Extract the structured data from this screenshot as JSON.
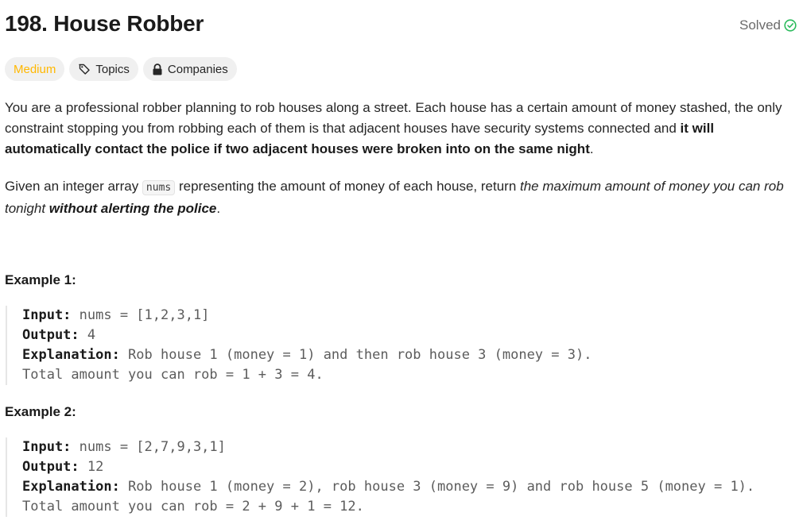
{
  "problem": {
    "title": "198. House Robber",
    "status": "Solved"
  },
  "tags": {
    "difficulty": "Medium",
    "topics": "Topics",
    "companies": "Companies"
  },
  "description": {
    "p1_text": "You are a professional robber planning to rob houses along a street. Each house has a certain amount of money stashed, the only constraint stopping you from robbing each of them is that adjacent houses have security systems connected and ",
    "p1_bold": "it will automatically contact the police if two adjacent houses were broken into on the same night",
    "p1_end": ".",
    "p2_text1": "Given an integer array ",
    "p2_code": "nums",
    "p2_text2": " representing the amount of money of each house, return ",
    "p2_italic": "the maximum amount of money you can rob tonight ",
    "p2_bolditalic": "without alerting the police",
    "p2_end": "."
  },
  "examples": [
    {
      "title": "Example 1:",
      "input_label": "Input:",
      "input_value": " nums = [1,2,3,1]",
      "output_label": "Output:",
      "output_value": " 4",
      "explanation_label": "Explanation:",
      "explanation_value": " Rob house 1 (money = 1) and then rob house 3 (money = 3).",
      "explanation_line2": "Total amount you can rob = 1 + 3 = 4."
    },
    {
      "title": "Example 2:",
      "input_label": "Input:",
      "input_value": " nums = [2,7,9,3,1]",
      "output_label": "Output:",
      "output_value": " 12",
      "explanation_label": "Explanation:",
      "explanation_value": " Rob house 1 (money = 2), rob house 3 (money = 9) and rob house 5 (money = 1).",
      "explanation_line2": "Total amount you can rob = 2 + 9 + 1 = 12."
    }
  ],
  "colors": {
    "difficulty_medium": "#ffb800",
    "solved_check": "#2cbb5d",
    "tag_bg": "#f0f0f0"
  }
}
